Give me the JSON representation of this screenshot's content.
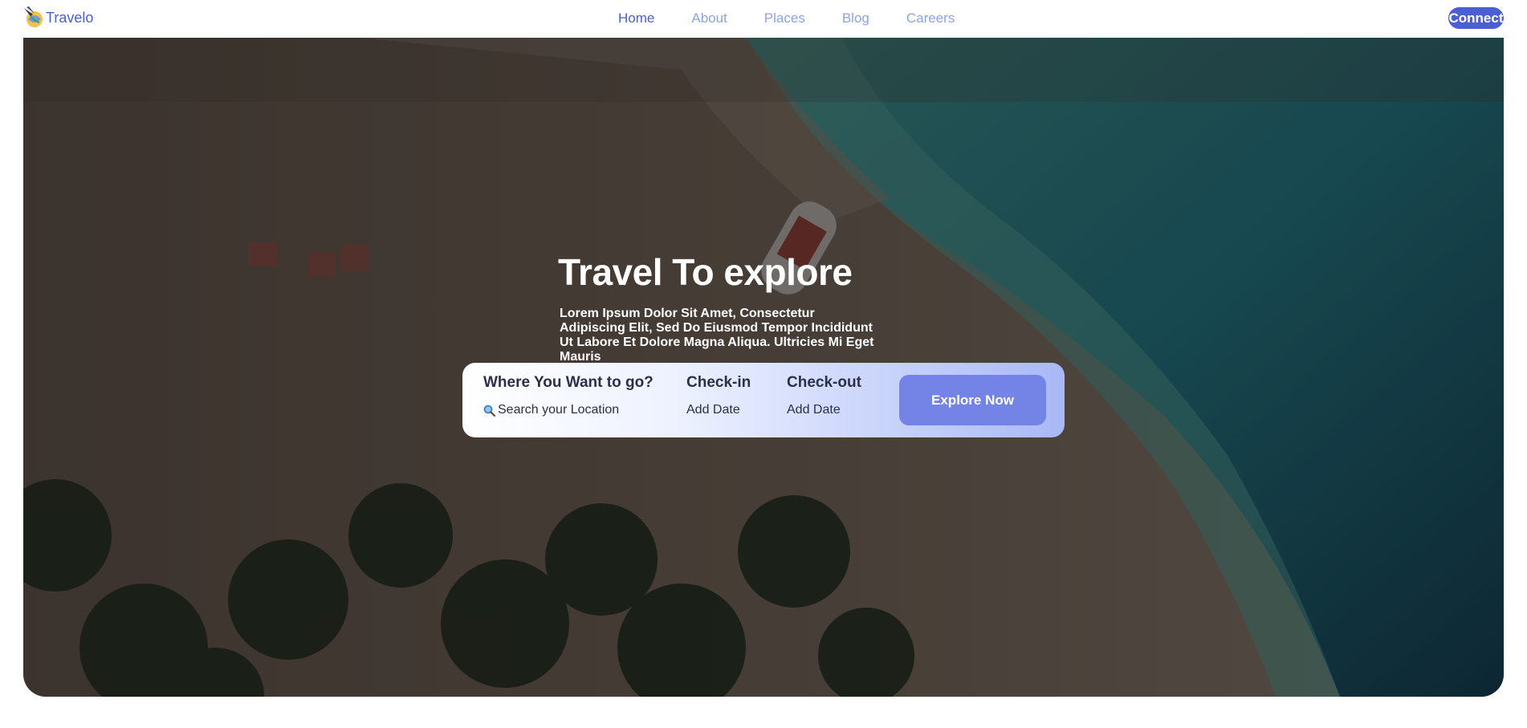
{
  "brand": {
    "name": "Travelo",
    "logo_icon": "plane-globe-icon"
  },
  "nav": {
    "links": [
      {
        "label": "Home",
        "active": true
      },
      {
        "label": "About",
        "active": false
      },
      {
        "label": "Places",
        "active": false
      },
      {
        "label": "Blog",
        "active": false
      },
      {
        "label": "Careers",
        "active": false
      }
    ],
    "connect_label": "Connect"
  },
  "hero": {
    "title": "Travel To explore",
    "description": "Lorem Ipsum Dolor Sit Amet, Consectetur Adipiscing Elit, Sed Do Eiusmod Tempor Incididunt Ut Labore Et Dolore Magna Aliqua. Ultricies Mi Eget Mauris"
  },
  "search": {
    "where_label": "Where You Want to go?",
    "where_value": "Search your Location",
    "where_icon": "magnifier-icon",
    "checkin_label": "Check-in",
    "checkin_value": "Add Date",
    "checkout_label": "Check-out",
    "checkout_value": "Add Date",
    "explore_label": "Explore Now"
  },
  "colors": {
    "accent": "#4a5fd1",
    "nav_inactive": "#8fa2e6",
    "explore_button": "#7383e6",
    "card_text": "#2b2f4a"
  }
}
